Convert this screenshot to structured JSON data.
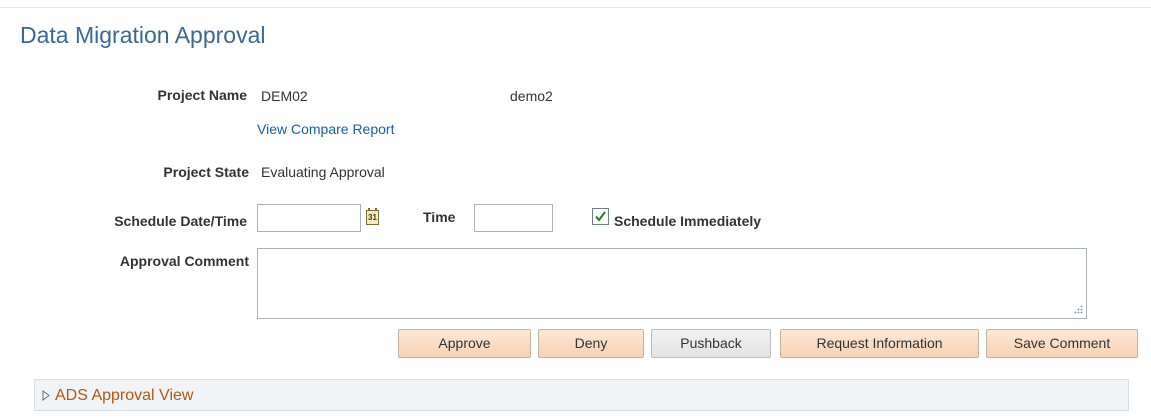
{
  "page": {
    "title": "Data Migration Approval"
  },
  "project": {
    "name_label": "Project Name",
    "name_code": "DEM02",
    "name_desc": "demo2",
    "compare_link": "View Compare Report",
    "state_label": "Project State",
    "state_value": "Evaluating Approval"
  },
  "schedule": {
    "date_label": "Schedule Date/Time",
    "date_value": "",
    "calendar_glyph": "31",
    "time_label": "Time",
    "time_value": "",
    "immediate_label": "Schedule Immediately",
    "immediate_checked": true
  },
  "comment": {
    "label": "Approval Comment",
    "value": ""
  },
  "buttons": {
    "approve": "Approve",
    "deny": "Deny",
    "pushback": "Pushback",
    "request_info": "Request Information",
    "save_comment": "Save Comment"
  },
  "ads_section": {
    "label": "ADS Approval View",
    "expanded": false
  },
  "colors": {
    "title": "#3a6994",
    "link": "#1a5ea8",
    "section_link": "#b5570d",
    "button_primary": "#f7d2b2"
  }
}
